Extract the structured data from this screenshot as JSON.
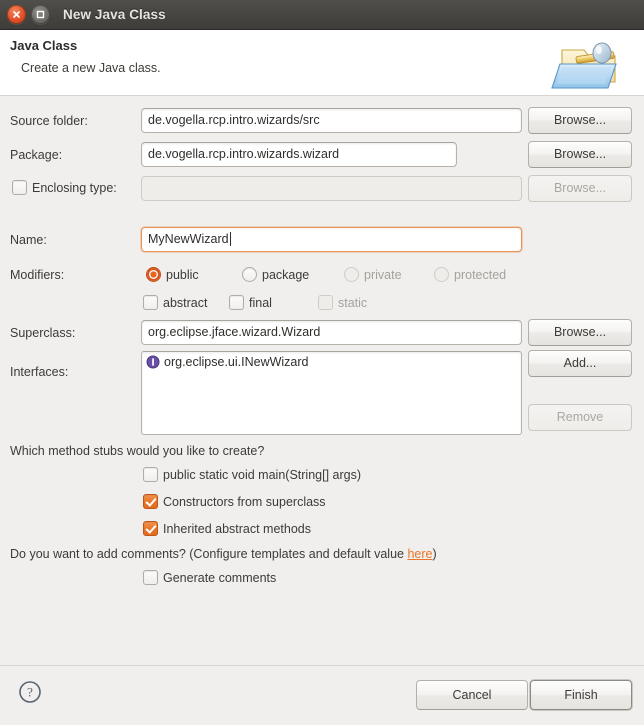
{
  "window": {
    "title": "New Java Class",
    "close_icon": "close-icon",
    "maximize_icon": "maximize-icon"
  },
  "banner": {
    "title": "Java Class",
    "subtitle": "Create a new Java class.",
    "art_icon": "new-java-class-wizard-icon"
  },
  "form": {
    "source_folder": {
      "label": "Source folder:",
      "value": "de.vogella.rcp.intro.wizards/src",
      "button": "Browse..."
    },
    "package": {
      "label": "Package:",
      "value": "de.vogella.rcp.intro.wizards.wizard",
      "button": "Browse..."
    },
    "enclosing_type": {
      "label": "Enclosing type:",
      "value": "",
      "button": "Browse...",
      "checked": false,
      "enabled": false
    },
    "name": {
      "label": "Name:",
      "value": "MyNewWizard"
    },
    "modifiers": {
      "label": "Modifiers:",
      "radios": [
        {
          "label": "public",
          "checked": true,
          "enabled": true
        },
        {
          "label": "package",
          "checked": false,
          "enabled": true
        },
        {
          "label": "private",
          "checked": false,
          "enabled": false
        },
        {
          "label": "protected",
          "checked": false,
          "enabled": false
        }
      ],
      "checkboxes": [
        {
          "label": "abstract",
          "checked": false,
          "enabled": true
        },
        {
          "label": "final",
          "checked": false,
          "enabled": true
        },
        {
          "label": "static",
          "checked": false,
          "enabled": false
        }
      ]
    },
    "superclass": {
      "label": "Superclass:",
      "value": "org.eclipse.jface.wizard.Wizard",
      "button": "Browse..."
    },
    "interfaces": {
      "label": "Interfaces:",
      "items": [
        {
          "name": "org.eclipse.ui.INewWizard",
          "icon": "java-interface-icon"
        }
      ],
      "add_button": "Add...",
      "remove_button": "Remove"
    },
    "method_stubs": {
      "question": "Which method stubs would you like to create?",
      "options": [
        {
          "label": "public static void main(String[] args)",
          "checked": false
        },
        {
          "label": "Constructors from superclass",
          "checked": true
        },
        {
          "label": "Inherited abstract methods",
          "checked": true
        }
      ]
    },
    "comments": {
      "question_pre": "Do you want to add comments? (Configure templates and default value ",
      "link": "here",
      "question_post": ")",
      "option": {
        "label": "Generate comments",
        "checked": false
      }
    }
  },
  "footer": {
    "help_icon": "help-icon",
    "cancel": "Cancel",
    "finish": "Finish"
  },
  "colors": {
    "accent": "#e8762a",
    "titlebar": "#45433f",
    "close_button": "#e0512b",
    "link": "#e8762a",
    "interface_icon": "#6a4fa8"
  }
}
